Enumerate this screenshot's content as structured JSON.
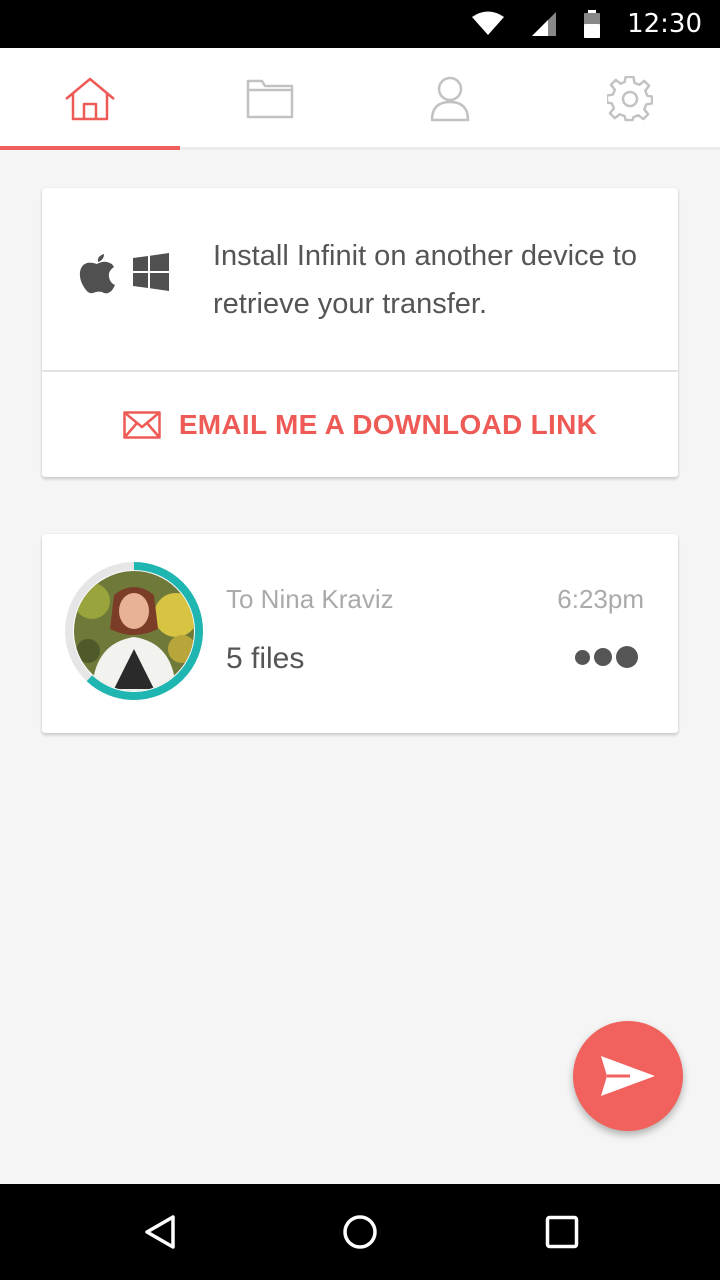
{
  "status_bar": {
    "time": "12:30",
    "icons": [
      "wifi-icon",
      "cell-signal-icon",
      "battery-icon"
    ]
  },
  "tabs": [
    {
      "id": "home",
      "icon": "home-icon",
      "active": true
    },
    {
      "id": "files",
      "icon": "folder-icon",
      "active": false
    },
    {
      "id": "contacts",
      "icon": "person-icon",
      "active": false
    },
    {
      "id": "settings",
      "icon": "gear-icon",
      "active": false
    }
  ],
  "install_card": {
    "platform_icons": [
      "apple-icon",
      "windows-icon"
    ],
    "message": "Install Infinit on another device to retrieve your transfer.",
    "action_icon": "envelope-icon",
    "action_label": "EMAIL ME A DOWNLOAD LINK"
  },
  "transfer": {
    "recipient": "To Nina Kraviz",
    "time": "6:23pm",
    "files": "5 files",
    "progress": 0.62,
    "menu_icon": "more-dots-icon"
  },
  "fab": {
    "icon": "send-icon"
  },
  "nav": [
    {
      "icon": "back-triangle-icon"
    },
    {
      "icon": "home-circle-icon"
    },
    {
      "icon": "recents-square-icon"
    }
  ],
  "colors": {
    "accent": "#ee5a55",
    "progress": "#1fb5b1",
    "background": "#f5f5f5",
    "text_primary": "#555555",
    "text_secondary": "#aaaaaa"
  }
}
